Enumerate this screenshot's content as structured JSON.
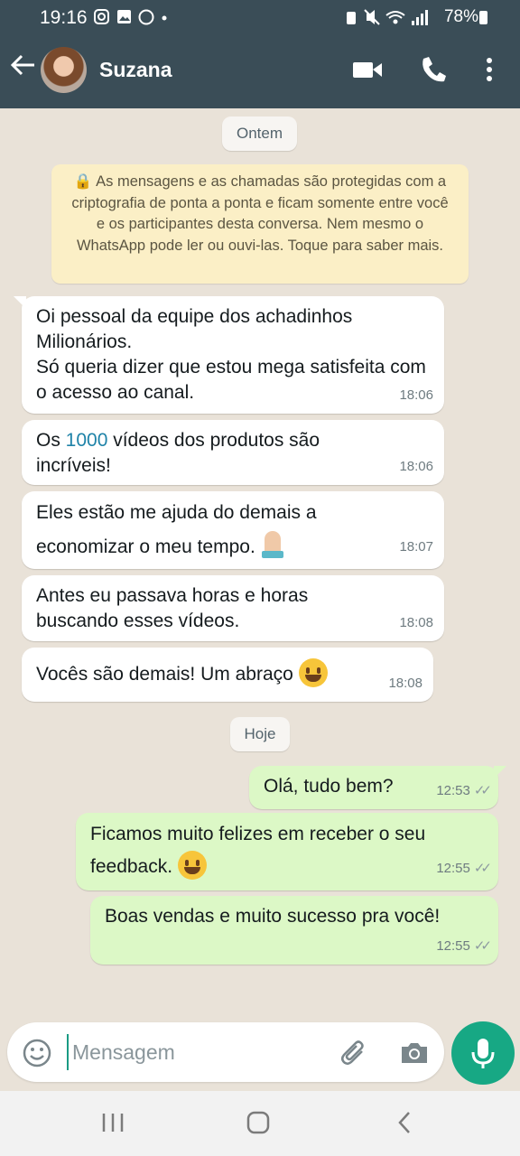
{
  "status_bar": {
    "time": "19:16",
    "battery": "78%"
  },
  "header": {
    "contact_name": "Suzana"
  },
  "chat": {
    "date_yesterday": "Ontem",
    "encryption_notice": "🔒 As mensagens e as chamadas são protegidas com a criptografia de ponta a ponta e ficam somente entre você e os participantes desta conversa. Nem mesmo o WhatsApp pode ler ou ouvi-las. Toque para saber mais.",
    "incoming": [
      {
        "text": "Oi pessoal da equipe dos achadinhos Milionários.\nSó queria dizer que estou mega satisfeita com o acesso ao canal.",
        "time": "18:06"
      },
      {
        "text_before": "Os ",
        "link": "1000",
        "text_after": " vídeos dos produtos são incríveis!",
        "time": "18:06"
      },
      {
        "text": "Eles estão me ajuda do demais a economizar o meu tempo.",
        "emoji": "folded-hands",
        "time": "18:07"
      },
      {
        "text": "Antes eu passava horas e horas buscando esses vídeos.",
        "time": "18:08"
      },
      {
        "text": "Vocês são demais! Um abraço",
        "emoji": "grinning-face",
        "time": "18:08"
      }
    ],
    "date_today": "Hoje",
    "outgoing": [
      {
        "text": "Olá, tudo bem?",
        "time": "12:53"
      },
      {
        "text": "Ficamos muito felizes em receber o seu feedback.",
        "emoji": "smiling-face",
        "time": "12:55"
      },
      {
        "text": "Boas vendas e muito sucesso pra você!",
        "time": "12:55"
      }
    ]
  },
  "input": {
    "placeholder": "Mensagem"
  },
  "colors": {
    "header": "#3a4d57",
    "incoming_bubble": "#ffffff",
    "outgoing_bubble": "#dcf8c6",
    "accent": "#17a884",
    "link": "#1f83a8"
  }
}
